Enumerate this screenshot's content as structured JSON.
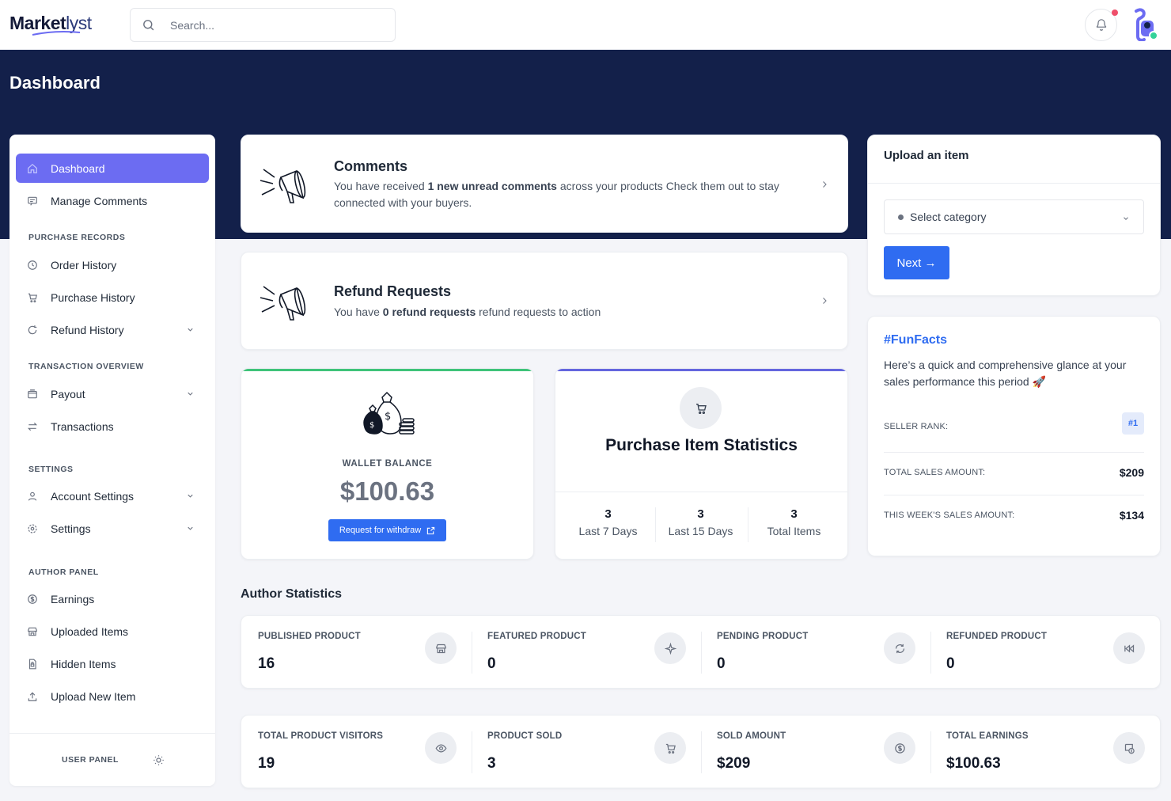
{
  "brand": {
    "name_bold": "Market",
    "name_light": "lyst"
  },
  "search": {
    "placeholder": "Search..."
  },
  "page_title": "Dashboard",
  "sidebar": {
    "items": [
      {
        "label": "Dashboard",
        "icon": "home-icon"
      },
      {
        "label": "Manage Comments",
        "icon": "comment-icon"
      },
      {
        "label": "Order History",
        "icon": "clock-icon"
      },
      {
        "label": "Purchase History",
        "icon": "cart-icon"
      },
      {
        "label": "Refund History",
        "icon": "refresh-icon"
      },
      {
        "label": "Payout",
        "icon": "wallet-icon"
      },
      {
        "label": "Transactions",
        "icon": "transfer-icon"
      },
      {
        "label": "Account Settings",
        "icon": "user-icon"
      },
      {
        "label": "Settings",
        "icon": "gear-icon"
      },
      {
        "label": "Earnings",
        "icon": "dollar-icon"
      },
      {
        "label": "Uploaded Items",
        "icon": "store-icon"
      },
      {
        "label": "Hidden Items",
        "icon": "file-lock-icon"
      },
      {
        "label": "Upload New Item",
        "icon": "upload-icon"
      }
    ],
    "sections": {
      "purchase": "PURCHASE RECORDS",
      "transaction": "TRANSACTION OVERVIEW",
      "settings": "SETTINGS",
      "author": "AUTHOR PANEL"
    },
    "footer_label": "USER PANEL"
  },
  "comments": {
    "title": "Comments",
    "text_before": "You have received ",
    "text_bold": "1 new unread comments",
    "text_after": " across your products Check them out to stay connected with your buyers."
  },
  "refunds": {
    "title": "Refund Requests",
    "text_before": "You have ",
    "text_bold": "0 refund requests",
    "text_after": " refund requests to action"
  },
  "wallet": {
    "label": "WALLET BALANCE",
    "amount": "$100.63",
    "button_label": "Request for withdraw"
  },
  "purchase_stats": {
    "title": "Purchase Item Statistics",
    "stats": [
      {
        "value": "3",
        "label": "Last 7 Days"
      },
      {
        "value": "3",
        "label": "Last 15 Days"
      },
      {
        "value": "3",
        "label": "Total Items"
      }
    ]
  },
  "upload": {
    "title": "Upload an item",
    "select_value": "Select category",
    "next_label": "Next →"
  },
  "fun_facts": {
    "title": "#FunFacts",
    "text": "Here’s a quick and comprehensive glance at your sales performance this period 🚀",
    "seller_rank_label": "SELLER RANK:",
    "seller_rank_value": "#1",
    "total_sales_label": "TOTAL SALES AMOUNT:",
    "total_sales_value": "$209",
    "week_sales_label": "THIS WEEK'S SALES AMOUNT:",
    "week_sales_value": "$134"
  },
  "author_stats": {
    "title": "Author Statistics",
    "row1": [
      {
        "label": "PUBLISHED PRODUCT",
        "value": "16",
        "icon": "store-icon"
      },
      {
        "label": "FEATURED PRODUCT",
        "value": "0",
        "icon": "sparkle-icon"
      },
      {
        "label": "PENDING PRODUCT",
        "value": "0",
        "icon": "refresh-icon"
      },
      {
        "label": "REFUNDED PRODUCT",
        "value": "0",
        "icon": "rewind-icon"
      }
    ],
    "row2": [
      {
        "label": "TOTAL PRODUCT VISITORS",
        "value": "19",
        "icon": "eye-icon"
      },
      {
        "label": "PRODUCT SOLD",
        "value": "3",
        "icon": "cart-icon"
      },
      {
        "label": "SOLD AMOUNT",
        "value": "$209",
        "icon": "dollar-icon"
      },
      {
        "label": "TOTAL EARNINGS",
        "value": "$100.63",
        "icon": "earnings-icon"
      }
    ]
  },
  "colors": {
    "accent": "#6c6cf2",
    "primary": "#2f6cf1",
    "banner": "#13204a",
    "wallet_bar": "#3fc37a",
    "stats_bar": "#6466de"
  }
}
